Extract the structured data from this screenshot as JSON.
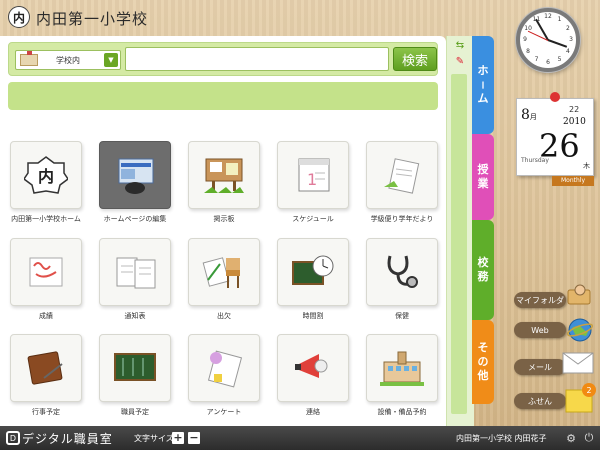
{
  "header": {
    "logo_glyph": "内",
    "title": "内田第一小学校"
  },
  "search": {
    "scope_label": "学校内",
    "scope_icon": "school-building-icon",
    "placeholder": "",
    "button_label": "検索"
  },
  "tiles": [
    {
      "label": "内田第一小学校ホーム",
      "icon": "school-crest-icon"
    },
    {
      "label": "ホームページの編集",
      "icon": "webpage-mouse-icon"
    },
    {
      "label": "掲示板",
      "icon": "bulletin-board-icon"
    },
    {
      "label": "スケジュール",
      "icon": "calendar-icon"
    },
    {
      "label": "学級便り学年だより",
      "icon": "handout-icon"
    },
    {
      "label": "成績",
      "icon": "grades-icon"
    },
    {
      "label": "通知表",
      "icon": "report-card-icon"
    },
    {
      "label": "出欠",
      "icon": "attendance-icon"
    },
    {
      "label": "時間割",
      "icon": "timetable-icon"
    },
    {
      "label": "保健",
      "icon": "stethoscope-icon"
    },
    {
      "label": "行事予定",
      "icon": "event-book-icon"
    },
    {
      "label": "職員予定",
      "icon": "staff-board-icon"
    },
    {
      "label": "アンケート",
      "icon": "survey-icon"
    },
    {
      "label": "連絡",
      "icon": "megaphone-icon"
    },
    {
      "label": "設備・備品予約",
      "icon": "facility-icon"
    }
  ],
  "tabs": [
    {
      "label": [
        "ホ",
        "|",
        "ム"
      ],
      "color": "#3a8fe0"
    },
    {
      "label": [
        "授",
        "業"
      ],
      "color": "#e04fb8"
    },
    {
      "label": [
        "校",
        "務"
      ],
      "color": "#5fae2a"
    },
    {
      "label": [
        "そ",
        "の",
        "他"
      ],
      "color": "#f08c18"
    }
  ],
  "clock": {
    "numbers": [
      "12",
      "1",
      "2",
      "3",
      "4",
      "5",
      "6",
      "7",
      "8",
      "9",
      "10",
      "11"
    ]
  },
  "calendar": {
    "month": "8",
    "month_suffix": "月",
    "day_small": "22",
    "year": "2010",
    "day": "26",
    "weekday_en": "Thursday",
    "weekday_jp": "木",
    "monthly_label": "Monthly"
  },
  "shortcuts": [
    {
      "label": "マイフォルダ",
      "icon": "my-folder-icon"
    },
    {
      "label": "Web",
      "icon": "globe-icon"
    },
    {
      "label": "メール",
      "icon": "envelope-icon"
    },
    {
      "label": "ふせん",
      "icon": "sticky-note-icon",
      "badge": "2"
    }
  ],
  "footer": {
    "brand": "デジタル職員室",
    "font_size_label": "文字サイズ",
    "plus": "+",
    "minus": "−",
    "user": "内田第一小学校 内田花子"
  }
}
